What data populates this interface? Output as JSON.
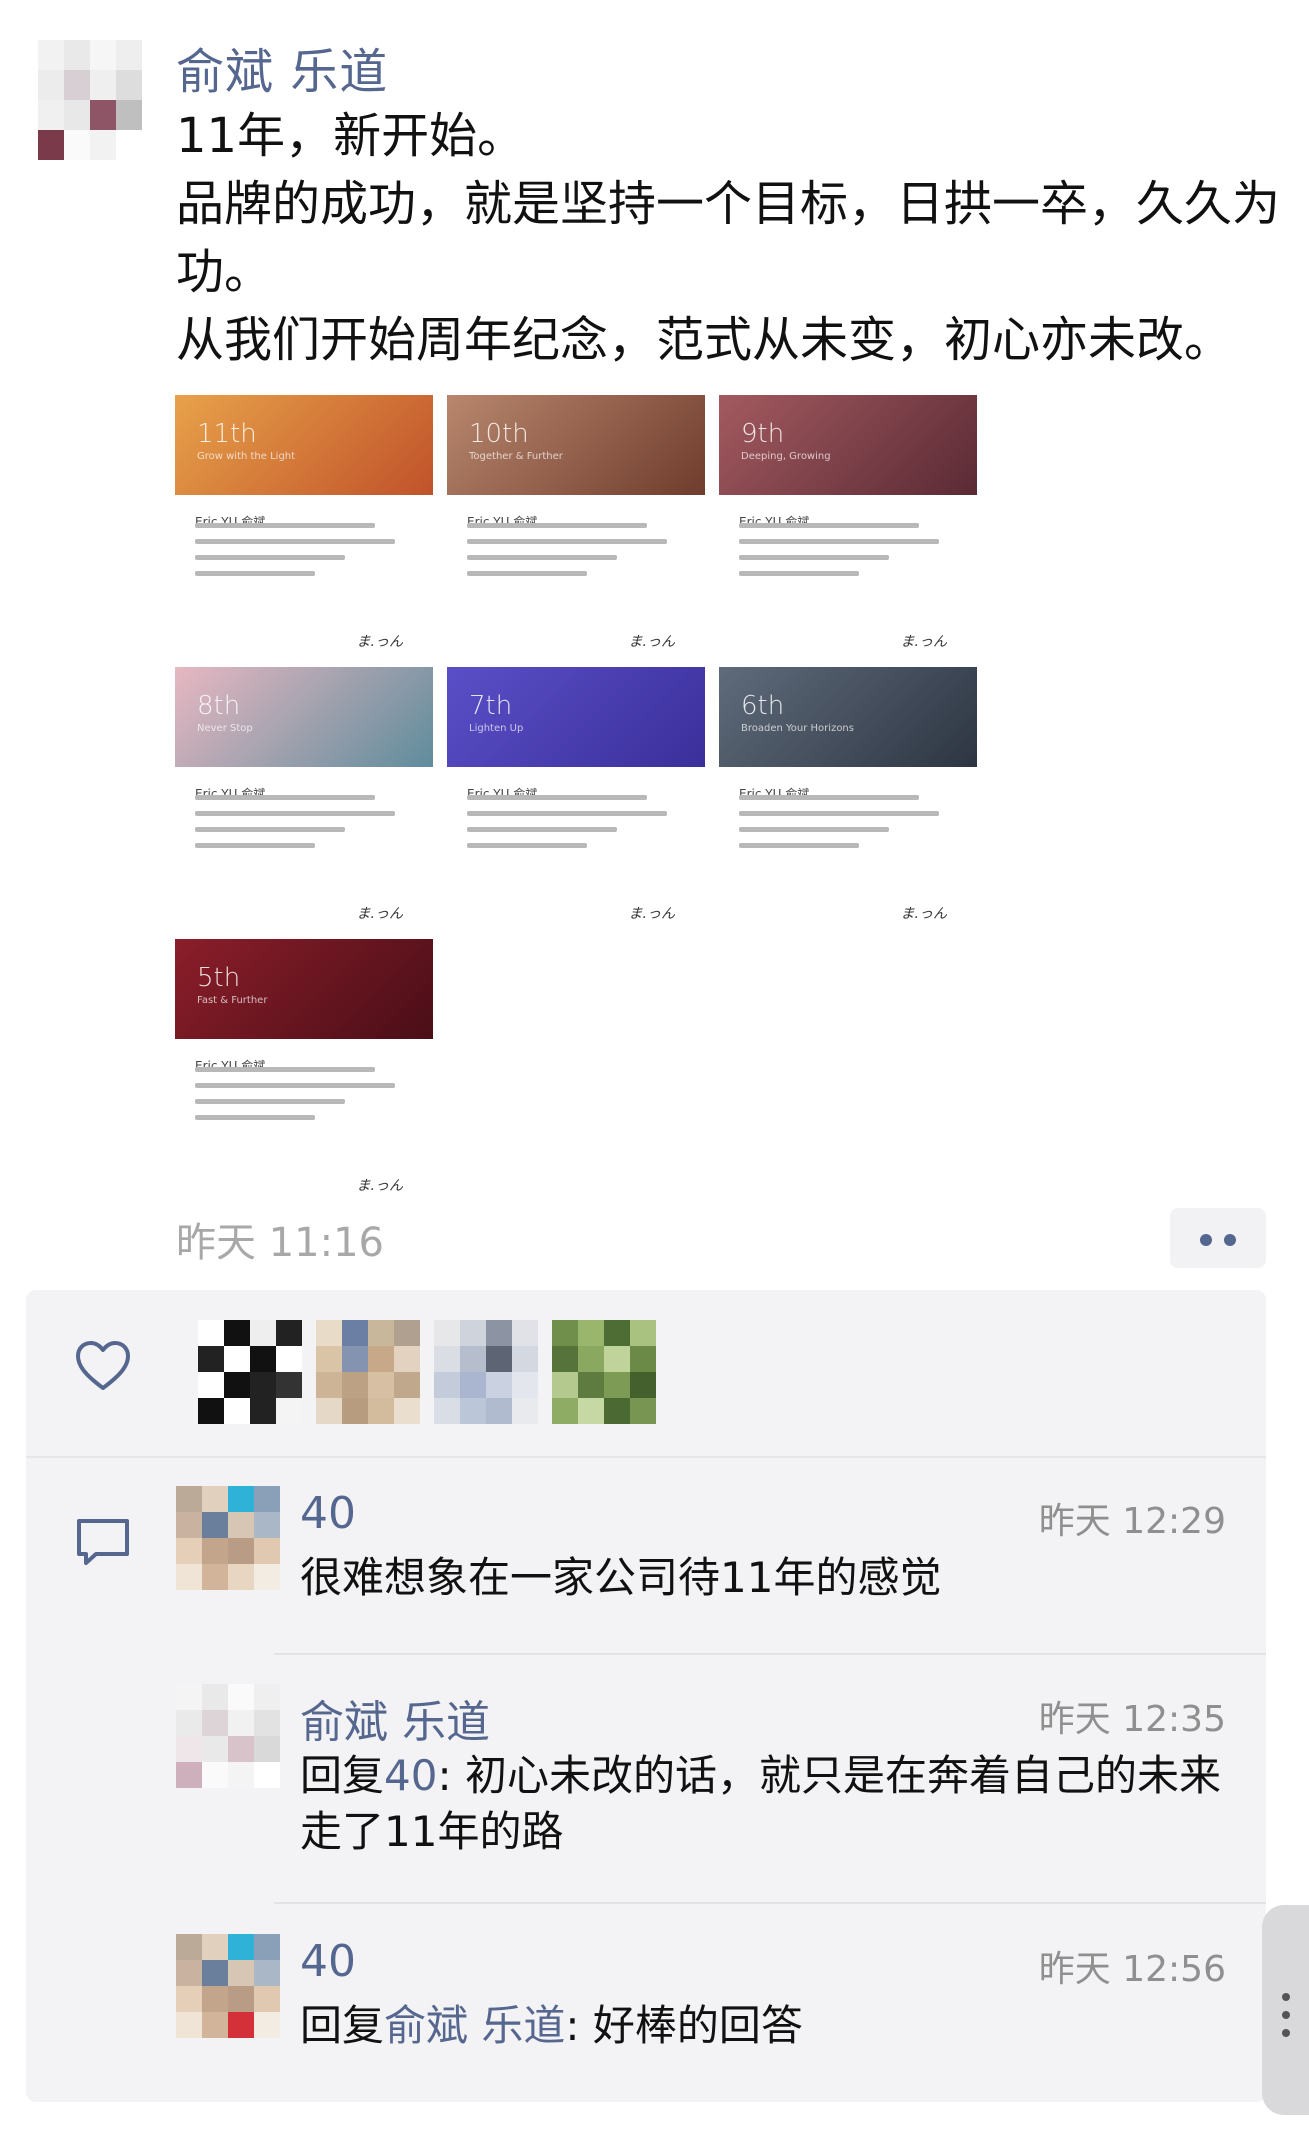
{
  "post": {
    "author": "俞斌 乐道",
    "lines": [
      "11年，新开始。",
      "品牌的成功，就是坚持一个目标，日拱一卒，久久为功。",
      "从我们开始周年纪念，范式从未变，初心亦未改。"
    ],
    "time": "昨天 11:16"
  },
  "cards": [
    {
      "num": "11th",
      "tag": "Grow with the Light",
      "sig": "Eric YU 俞斌",
      "sign": "ま.っん",
      "colors": [
        "#e8a24a",
        "#c0522a"
      ]
    },
    {
      "num": "10th",
      "tag": "Together & Further",
      "sig": "Eric YU 俞斌",
      "sign": "ま.っん",
      "colors": [
        "#b8876d",
        "#6f3c2d"
      ]
    },
    {
      "num": "9th",
      "tag": "Deeping, Growing",
      "sig": "Eric YU 俞斌",
      "sign": "ま.っん",
      "colors": [
        "#a35a5f",
        "#5a2a35"
      ]
    },
    {
      "num": "8th",
      "tag": "Never Stop",
      "sig": "Eric YU 俞斌",
      "sign": "ま.っん",
      "colors": [
        "#e7b8c2",
        "#5f8c9c"
      ]
    },
    {
      "num": "7th",
      "tag": "Lighten Up",
      "sig": "Eric YU 俞斌",
      "sign": "ま.っん",
      "colors": [
        "#5b4fc8",
        "#3a2f9a"
      ]
    },
    {
      "num": "6th",
      "tag": "Broaden Your Horizons",
      "sig": "Eric YU 俞斌",
      "sign": "ま.っん",
      "colors": [
        "#5f6b7b",
        "#2d3542"
      ]
    },
    {
      "num": "5th",
      "tag": "Fast & Further",
      "sig": "Eric YU 俞斌",
      "sign": "ま.っん",
      "colors": [
        "#8b1e2a",
        "#4a0e17"
      ]
    }
  ],
  "comments": [
    {
      "name": "40",
      "time": "昨天 12:29",
      "prefix": "",
      "reply_to": "",
      "text": "很难想象在一家公司待11年的感觉"
    },
    {
      "name": "俞斌 乐道",
      "time": "昨天 12:35",
      "prefix": "回复",
      "reply_to": "40",
      "text": ": 初心未改的话，就只是在奔着自己的未来走了11年的路"
    },
    {
      "name": "40",
      "time": "昨天 12:56",
      "prefix": "回复",
      "reply_to": "俞斌 乐道",
      "text": ": 好棒的回答"
    }
  ],
  "icons": {
    "like": "heart-icon",
    "comment": "comment-icon",
    "more": "more-dots-icon"
  },
  "colors": {
    "name": "#56678f",
    "time": "#a8a8a8",
    "panel": "#f3f3f5"
  }
}
